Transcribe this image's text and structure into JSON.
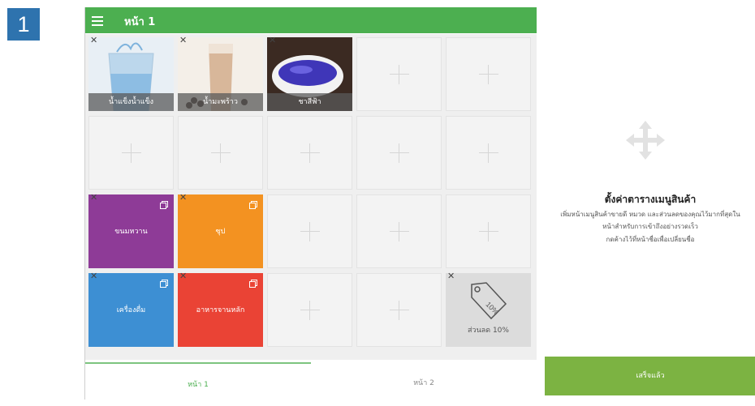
{
  "step": "1",
  "topbar": {
    "title": "หน้า 1"
  },
  "items": [
    {
      "label": "น้ำแข็งน้ำแข็ง",
      "image": "glass-of-water"
    },
    {
      "label": "น้ำมะพร้าว",
      "image": "iced-coffee"
    },
    {
      "label": "ชาสีฟ้า",
      "image": "blue-tea-bowl"
    }
  ],
  "categories": [
    {
      "label": "ขนมหวาน",
      "color": "#8e3b97"
    },
    {
      "label": "ซุป",
      "color": "#f39221"
    },
    {
      "label": "เครื่องดื่ม",
      "color": "#3d8fd3"
    },
    {
      "label": "อาหารจานหลัก",
      "color": "#ea4335"
    }
  ],
  "discount": {
    "label": "ส่วนลด 10%",
    "tag_text": "10%"
  },
  "tabs": [
    {
      "label": "หน้า 1",
      "active": true
    },
    {
      "label": "หน้า 2",
      "active": false
    }
  ],
  "panel": {
    "title": "ตั้งค่าตารางเมนูสินค้า",
    "desc1": "เพิ่มหน้าเมนูสินค้าขายดี หมวด และส่วนลดของคุณไว้มากที่สุดใน",
    "desc2": "หน้าสำหรับการเข้าถึงอย่างรวดเร็ว",
    "desc3": "กดค้างไว้ที่หน้าชื่อเพื่อเปลี่ยนชื่อ"
  },
  "done_button": "เสร็จแล้ว",
  "colors": {
    "accent": "#4caf50",
    "done": "#7cb342",
    "step_badge": "#2e73ae"
  }
}
